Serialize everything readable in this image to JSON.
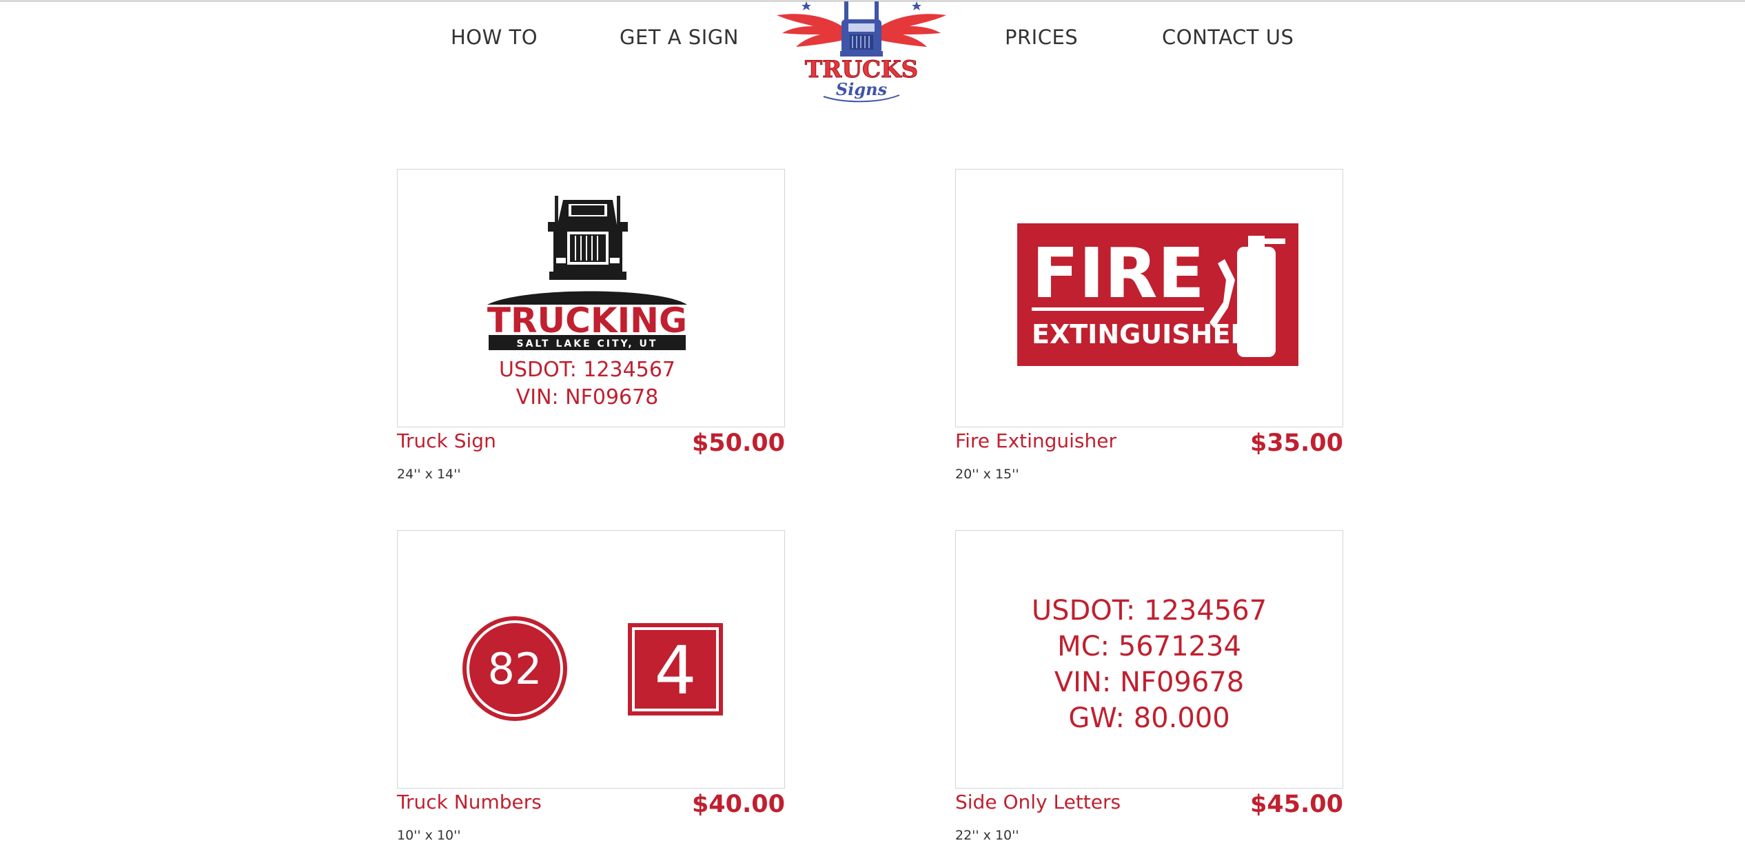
{
  "nav": {
    "how_to": "HOW TO",
    "get_a_sign": "GET A SIGN",
    "prices": "PRICES",
    "contact_us": "CONTACT US",
    "logo_text": "TRUCKS",
    "logo_subtext": "Signs"
  },
  "products": [
    {
      "name": "Truck Sign",
      "price": "$50.00",
      "size": "24'' x 14''",
      "preview": {
        "title": "TRUCKING",
        "subtitle": "SALT LAKE CITY, UT",
        "line1": "USDOT: 1234567",
        "line2": "VIN: NF09678"
      }
    },
    {
      "name": "Fire Extinguisher",
      "price": "$35.00",
      "size": "20'' x 15''",
      "preview": {
        "title": "FIRE",
        "subtitle": "EXTINGUISHER"
      }
    },
    {
      "name": "Truck Numbers",
      "price": "$40.00",
      "size": "10'' x 10''",
      "preview": {
        "circle_number": "82",
        "square_number": "4"
      }
    },
    {
      "name": "Side Only Letters",
      "price": "$45.00",
      "size": "22'' x 10''",
      "preview": {
        "lines": [
          "USDOT: 1234567",
          "MC: 5671234",
          "VIN: NF09678",
          "GW: 80.000"
        ]
      }
    }
  ],
  "colors": {
    "brand_red": "#c0202f",
    "brand_blue": "#3f55a8",
    "nav_text": "#333333"
  }
}
